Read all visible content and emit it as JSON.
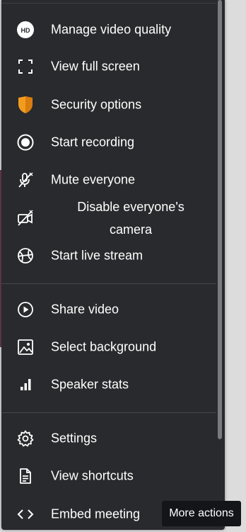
{
  "menu": {
    "items": [
      {
        "label": "Manage video quality",
        "icon": "hd-icon"
      },
      {
        "label": "View full screen",
        "icon": "fullscreen-icon"
      },
      {
        "label": "Security options",
        "icon": "shield-icon"
      },
      {
        "label": "Start recording",
        "icon": "record-icon"
      },
      {
        "label": "Mute everyone",
        "icon": "mic-off-icon"
      },
      {
        "label": "Disable everyone's camera",
        "icon": "camera-off-icon"
      },
      {
        "label": "Start live stream",
        "icon": "live-stream-icon"
      },
      {
        "label": "Share video",
        "icon": "play-circle-icon"
      },
      {
        "label": "Select background",
        "icon": "image-icon"
      },
      {
        "label": "Speaker stats",
        "icon": "bar-chart-icon"
      },
      {
        "label": "Settings",
        "icon": "gear-icon"
      },
      {
        "label": "View shortcuts",
        "icon": "document-icon"
      },
      {
        "label": "Embed meeting",
        "icon": "code-icon"
      }
    ]
  },
  "tooltip": {
    "text": "More actions"
  },
  "colors": {
    "menu_bg": "#292a2d",
    "text": "#ffffff",
    "shield": "#f29c1f",
    "tooltip_bg": "#131519"
  }
}
